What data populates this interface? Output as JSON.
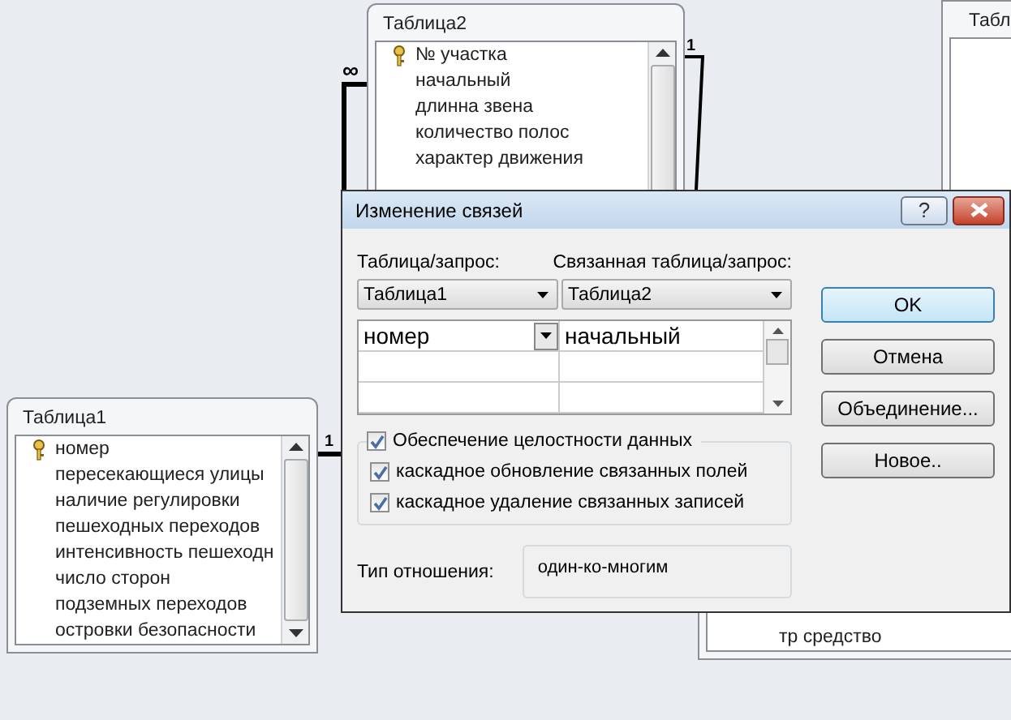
{
  "tables": [
    {
      "title": "Таблица2",
      "fields": [
        {
          "name": "№ участка",
          "primary_key": true
        },
        {
          "name": "начальный",
          "primary_key": false
        },
        {
          "name": "длинна звена",
          "primary_key": false
        },
        {
          "name": "количество полос",
          "primary_key": false
        },
        {
          "name": "характер движения",
          "primary_key": false
        }
      ]
    },
    {
      "title": "Табл"
    },
    {
      "title": "Таблица1",
      "fields": [
        {
          "name": "номер",
          "primary_key": true
        },
        {
          "name": "пересекающиеся улицы",
          "primary_key": false
        },
        {
          "name": "наличие регулировки",
          "primary_key": false
        },
        {
          "name": "пешеходных переходов",
          "primary_key": false
        },
        {
          "name": "интенсивность пешеходн",
          "primary_key": false
        },
        {
          "name": "число сторон",
          "primary_key": false
        },
        {
          "name": "подземных переходов",
          "primary_key": false
        },
        {
          "name": "островки безопасности",
          "primary_key": false
        }
      ]
    },
    {
      "fields": [
        {
          "name": "тр средство",
          "primary_key": false
        }
      ]
    }
  ],
  "relationships": [
    {
      "one_label": "1",
      "many_label": "∞"
    },
    {
      "one_label": "1"
    }
  ],
  "dialog": {
    "title": "Изменение связей",
    "help_button": "?",
    "table_label": "Таблица/запрос:",
    "related_label": "Связанная таблица/запрос:",
    "table_value": "Таблица1",
    "related_value": "Таблица2",
    "join_rows": [
      {
        "left": "номер",
        "right": "начальный"
      }
    ],
    "buttons": [
      "OK",
      "Отмена",
      "Объединение...",
      "Новое.."
    ],
    "integrity": {
      "label": "Обеспечение целостности данных",
      "checked": true
    },
    "options": [
      {
        "label": "каскадное обновление связанных полей",
        "checked": true
      },
      {
        "label": "каскадное удаление связанных записей",
        "checked": true
      }
    ],
    "relation_type_label": "Тип отношения:",
    "relation_type": "один-ко-многим"
  }
}
